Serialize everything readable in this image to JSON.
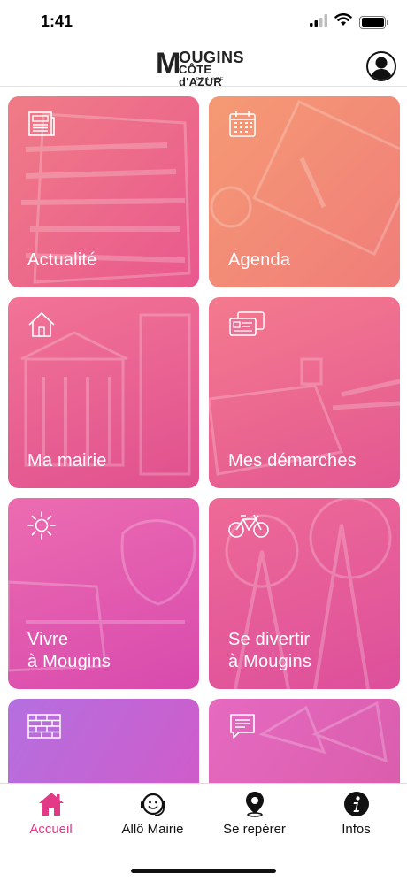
{
  "status_bar": {
    "time": "1:41"
  },
  "header": {
    "logo": {
      "initial": "M",
      "line1": "OUGINS",
      "line2": "CÔTE d'AZUR",
      "line3": "FRANCE"
    },
    "profile_icon": "profile-icon"
  },
  "tiles": [
    {
      "label": "Actualité",
      "icon": "newspaper-icon"
    },
    {
      "label": "Agenda",
      "icon": "calendar-icon"
    },
    {
      "label": "Ma mairie",
      "icon": "house-icon"
    },
    {
      "label": "Mes démarches",
      "icon": "id-cards-icon"
    },
    {
      "label": "Vivre\nà Mougins",
      "icon": "sun-icon"
    },
    {
      "label": "Se divertir\nà Mougins",
      "icon": "bicycle-icon"
    },
    {
      "label": "",
      "icon": "brick-wall-icon"
    },
    {
      "label": "",
      "icon": "speech-bubble-icon"
    }
  ],
  "tabbar": {
    "items": [
      {
        "label": "Accueil",
        "icon": "home-icon",
        "active": true
      },
      {
        "label": "Allô Mairie",
        "icon": "headset-icon",
        "active": false
      },
      {
        "label": "Se repérer",
        "icon": "map-pin-icon",
        "active": false
      },
      {
        "label": "Infos",
        "icon": "info-icon",
        "active": false
      }
    ]
  },
  "colors": {
    "accent": "#e23a86",
    "tile_gradients": [
      [
        "#f07c86",
        "#e9588f"
      ],
      [
        "#f59a74",
        "#f07d7a"
      ],
      [
        "#f27496",
        "#e0508f"
      ],
      [
        "#f47a8e",
        "#e35792"
      ],
      [
        "#ec6cb0",
        "#d84aae"
      ],
      [
        "#ee6a96",
        "#dd4f9c"
      ],
      [
        "#b46fe0",
        "#d657c5"
      ],
      [
        "#e56ac0",
        "#d85aa8"
      ]
    ]
  }
}
